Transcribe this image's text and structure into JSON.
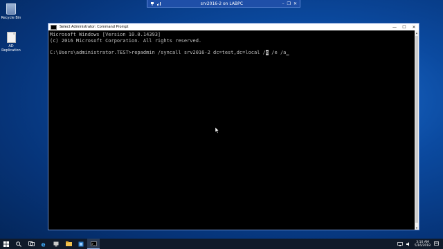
{
  "rdp_bar": {
    "title": "srv2016-2 on LABPC"
  },
  "desktop": {
    "icons": [
      {
        "label": "Recycle Bin"
      },
      {
        "label": "AD Replication"
      }
    ]
  },
  "cmd_window": {
    "title": "Select Administrator: Command Prompt",
    "lines": [
      "Microsoft Windows [Version 10.0.14393]",
      "(c) 2016 Microsoft Corporation. All rights reserved.",
      "",
      "C:\\Users\\administrator.TEST>repadmin /syncall srv2016-2 dc=test,dc=local /"
    ],
    "selected_char": "e",
    "trailing_text": " /e /a",
    "controls": {
      "minimize": "—",
      "maximize": "☐",
      "close": "✕"
    }
  },
  "taskbar": {
    "clock": {
      "time": "3:10 AM",
      "date": "5/16/2018"
    },
    "colors": {
      "accent": "#8fb0e8"
    }
  }
}
